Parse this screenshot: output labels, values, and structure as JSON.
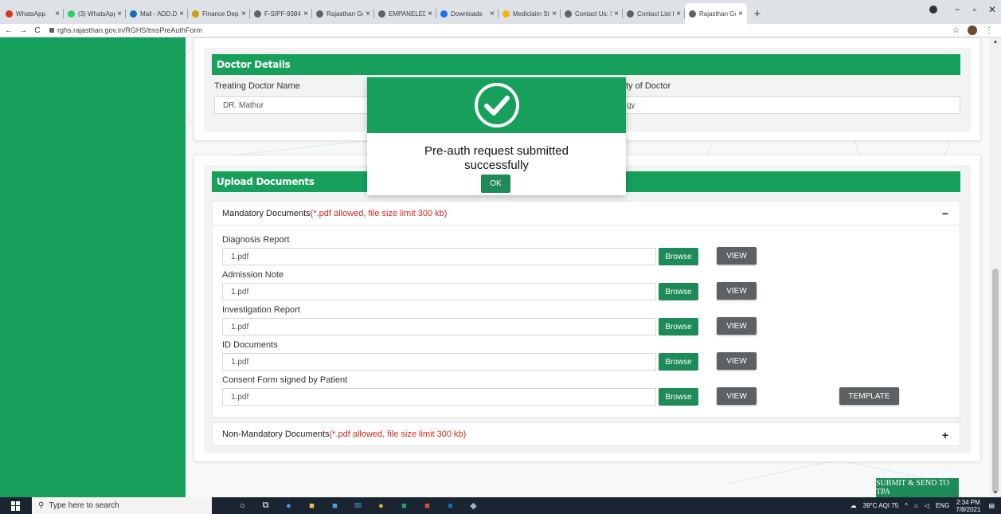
{
  "browser": {
    "tabs": [
      {
        "title": "WhatsApp",
        "icon": "alert-icon",
        "color": "#d93025"
      },
      {
        "title": "(3) WhatsApp",
        "icon": "whatsapp-icon",
        "color": "#25d366"
      },
      {
        "title": "Mail - ADD.DI",
        "icon": "outlook-icon",
        "color": "#0f6cbd"
      },
      {
        "title": "Finance Depa",
        "icon": "finance-icon",
        "color": "#c8a300"
      },
      {
        "title": "F-SIPF-9384-0",
        "icon": "globe-icon",
        "color": "#5f6368"
      },
      {
        "title": "Rajasthan Go",
        "icon": "globe-icon",
        "color": "#5f6368"
      },
      {
        "title": "EMPANELED",
        "icon": "globe-icon",
        "color": "#5f6368"
      },
      {
        "title": "Downloads",
        "icon": "download-icon",
        "color": "#1a73e8"
      },
      {
        "title": "Mediclaim St",
        "icon": "loading-icon",
        "color": "#f4b400"
      },
      {
        "title": "Contact Us: S",
        "icon": "globe-icon",
        "color": "#5f6368"
      },
      {
        "title": "Contact List E",
        "icon": "globe-icon",
        "color": "#5f6368"
      },
      {
        "title": "Rajasthan Go",
        "icon": "globe-icon",
        "color": "#5f6368",
        "active": true
      }
    ],
    "url": "rghs.rajasthan.gov.in/RGHS/tmsPreAuthForm"
  },
  "doctor_section": {
    "title": "Doctor Details",
    "name_label": "Treating Doctor Name",
    "name_value": "DR. Mathur",
    "specialty_label_partial": "ty of Doctor",
    "specialty_value_partial": "gy"
  },
  "upload_section": {
    "title": "Upload Documents",
    "mandatory_label": "Mandatory Documents",
    "mandatory_note": "(*.pdf allowed, file size limit 300 kb)",
    "mandatory_toggle": "−",
    "documents": [
      {
        "label": "Diagnosis Report",
        "value": "1.pdf",
        "browse": "Browse",
        "view": "VIEW"
      },
      {
        "label": "Admission Note",
        "value": "1.pdf",
        "browse": "Browse",
        "view": "VIEW"
      },
      {
        "label": "Investigation Report",
        "value": "1.pdf",
        "browse": "Browse",
        "view": "VIEW"
      },
      {
        "label": "ID Documents",
        "value": "1.pdf",
        "browse": "Browse",
        "view": "VIEW"
      },
      {
        "label": "Consent Form signed by Patient",
        "value": "1.pdf",
        "browse": "Browse",
        "view": "VIEW",
        "template": "TEMPLATE"
      }
    ],
    "non_mandatory_label": "Non-Mandatory Documents",
    "non_mandatory_note": "(*.pdf allowed, file size limit 300 kb)",
    "non_mandatory_toggle": "+"
  },
  "submit_label": "SUBMIT & SEND TO TPA",
  "modal": {
    "message_line1": "Pre-auth request submitted",
    "message_line2": "successfully",
    "ok_label": "OK"
  },
  "taskbar": {
    "search_placeholder": "Type here to search",
    "weather": "39°C AQI 75",
    "language": "ENG",
    "time": "2:34 PM",
    "date": "7/8/2021"
  },
  "colors": {
    "primary": "#16a05c",
    "button_green": "#1d8a57",
    "button_gray": "#5e6163",
    "note_red": "#d9261c"
  }
}
